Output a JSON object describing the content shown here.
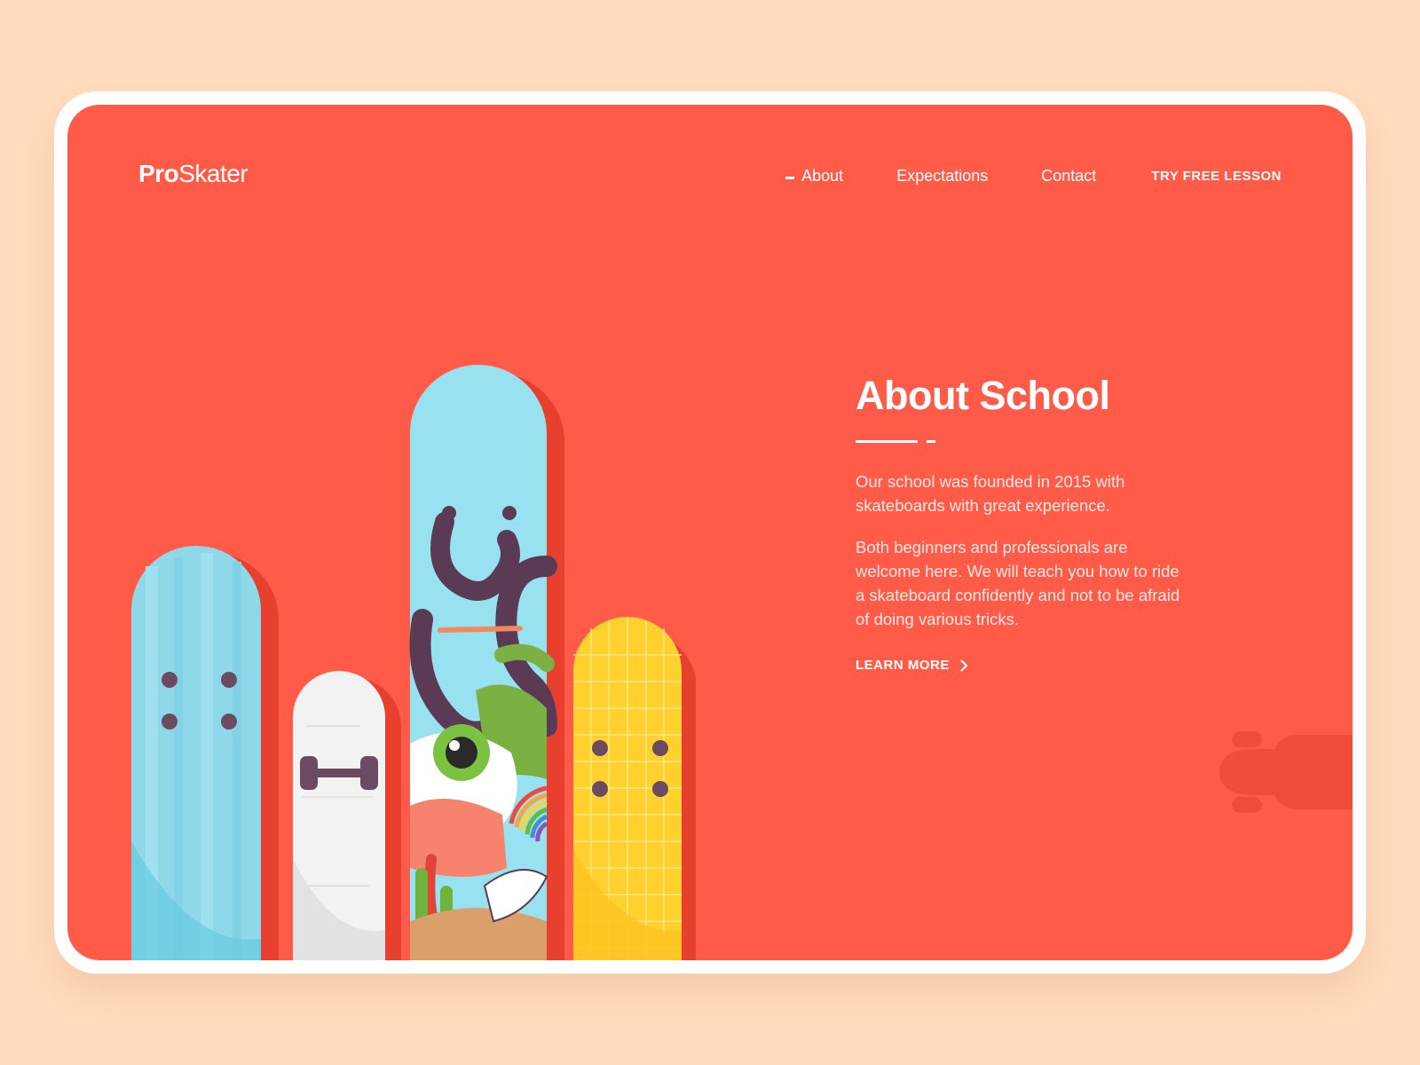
{
  "brand": {
    "name_bold": "Pro",
    "name_light": "Skater"
  },
  "nav": {
    "items": [
      {
        "label": "About",
        "active": true
      },
      {
        "label": "Expectations",
        "active": false
      },
      {
        "label": "Contact",
        "active": false
      }
    ],
    "cta": "TRY FREE LESSON"
  },
  "hero": {
    "title": "About School",
    "paragraph_1": "Our school was founded in 2015 with skateboards with great experience.",
    "paragraph_2": "Both beginners and professionals are welcome here. We will teach you how to ride a skateboard confidently and not to be afraid of doing various tricks.",
    "link": "LEARN MORE"
  },
  "colors": {
    "background": "#FFDCBD",
    "panel": "#FF5B48",
    "board_blue": "#8ED8EA",
    "board_white": "#F2F2F2",
    "board_sky": "#98E1F0",
    "board_yellow": "#FFD12E"
  },
  "icons": [
    "chevron-right-icon",
    "skateboard-icon"
  ]
}
